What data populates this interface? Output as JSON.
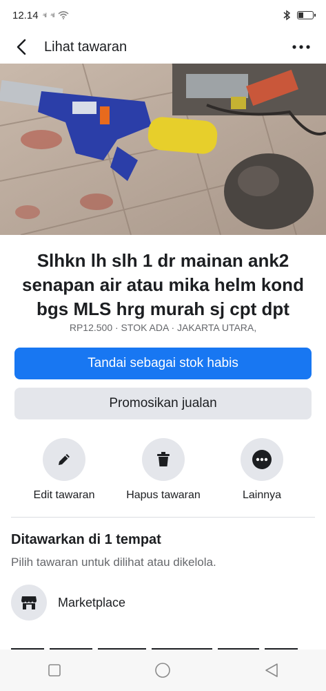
{
  "status_bar": {
    "time": "12.14",
    "signal_1": "⁴ıl",
    "signal_2": "⁴ıl"
  },
  "app_bar": {
    "title": "Lihat tawaran",
    "back_icon": "back-arrow-icon",
    "more_icon": "more-options-icon"
  },
  "photo": {
    "description_icon": "product-photo",
    "page_count": 7,
    "active_index": 0
  },
  "listing": {
    "title": "Slhkn lh slh 1 dr mainan ank2 senapan air atau mika helm kond bgs MLS hrg murah sj cpt dpt",
    "meta": "RP12.500 · STOK ADA · JAKARTA UTARA,"
  },
  "buttons": {
    "mark_sold": "Tandai sebagai stok habis",
    "promote": "Promosikan jualan"
  },
  "actions": [
    {
      "label": "Edit tawaran",
      "icon": "pencil-icon"
    },
    {
      "label": "Hapus tawaran",
      "icon": "trash-icon"
    },
    {
      "label": "Lainnya",
      "icon": "more-icon"
    }
  ],
  "section": {
    "title": "Ditawarkan di 1 tempat",
    "subtitle": "Pilih tawaran untuk dilihat atau dikelola.",
    "item": "Marketplace"
  },
  "colors": {
    "primary": "#1877f2",
    "secondary_bg": "#e4e6eb",
    "muted_text": "#65676b"
  }
}
